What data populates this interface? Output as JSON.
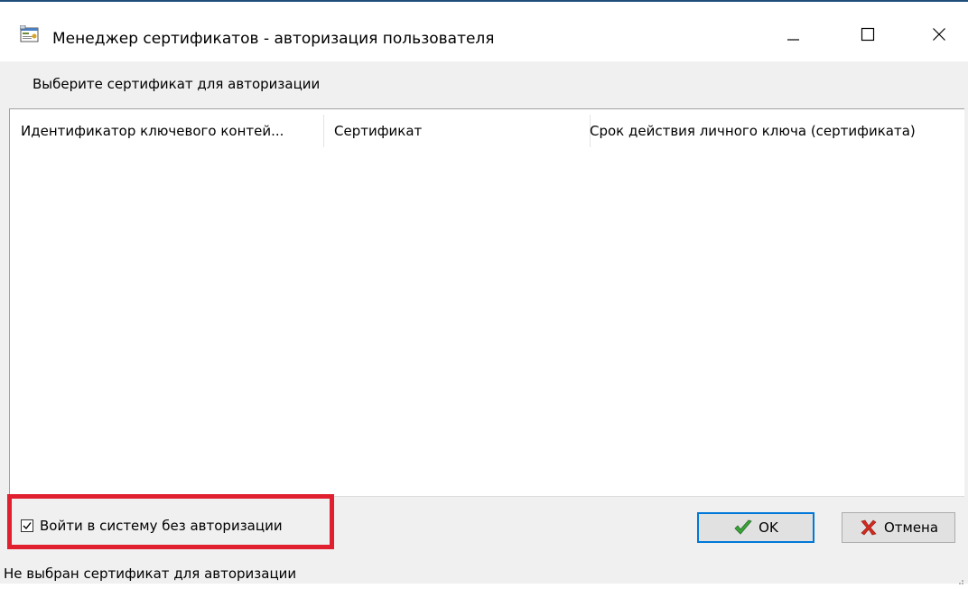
{
  "window": {
    "title": "Менеджер сертификатов - авторизация пользователя",
    "icon": "certificate-manager-icon",
    "controls": [
      "minimize-icon",
      "maximize-icon",
      "close-icon"
    ]
  },
  "subtitle": "Выберите сертификат для авторизации",
  "list": {
    "columns": [
      "Идентификатор ключевого контей...",
      "Сертификат",
      "Срок действия личного ключа (сертификата)"
    ],
    "rows": []
  },
  "login_without_auth": {
    "label": "Войти в систему без авторизации",
    "checked": true
  },
  "buttons": {
    "ok": {
      "label": "OK",
      "icon": "checkmark-icon"
    },
    "cancel": {
      "label": "Отмена",
      "icon": "cross-icon"
    }
  },
  "status": "Не выбран сертификат для авторизации",
  "colors": {
    "highlight": "#e0202f",
    "ok_border": "#0078d7",
    "check_green": "#3aa53a",
    "cancel_red": "#d42a1f"
  }
}
